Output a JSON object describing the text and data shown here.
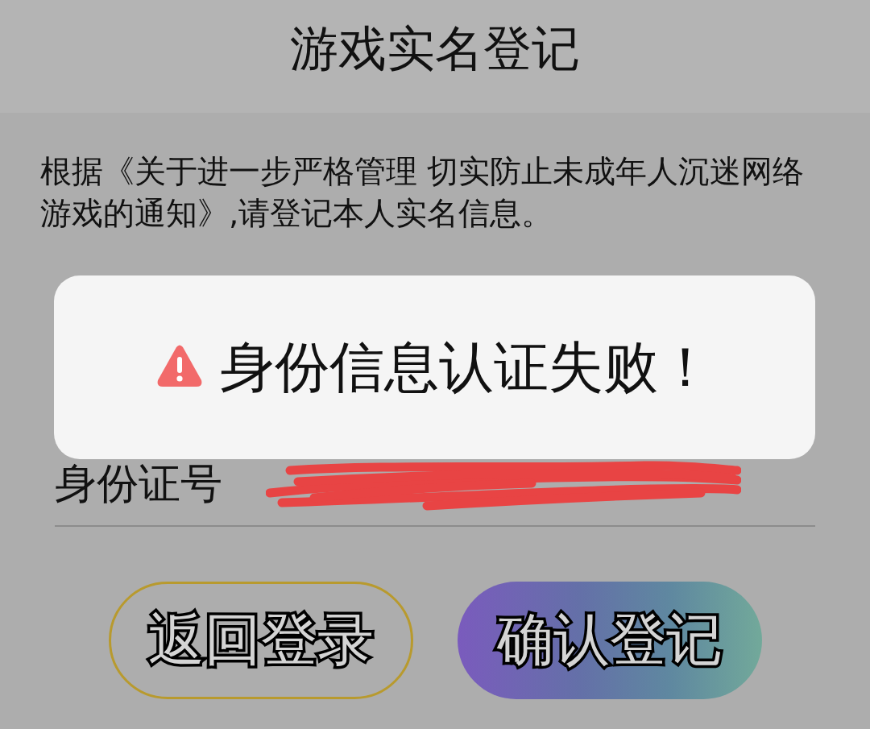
{
  "header": {
    "title": "游戏实名登记"
  },
  "notice": {
    "text": "根据《关于进一步严格管理 切实防止未成年人沉迷网络游戏的通知》,请登记本人实名信息。"
  },
  "form": {
    "fields": [
      {
        "label": "身份证号",
        "redacted": true
      }
    ]
  },
  "buttons": [
    {
      "label": "返回登录",
      "kind": "outline"
    },
    {
      "label": "确认登记",
      "kind": "gradient"
    }
  ],
  "toast": {
    "kind": "error",
    "message": "身份信息认证失败！"
  }
}
